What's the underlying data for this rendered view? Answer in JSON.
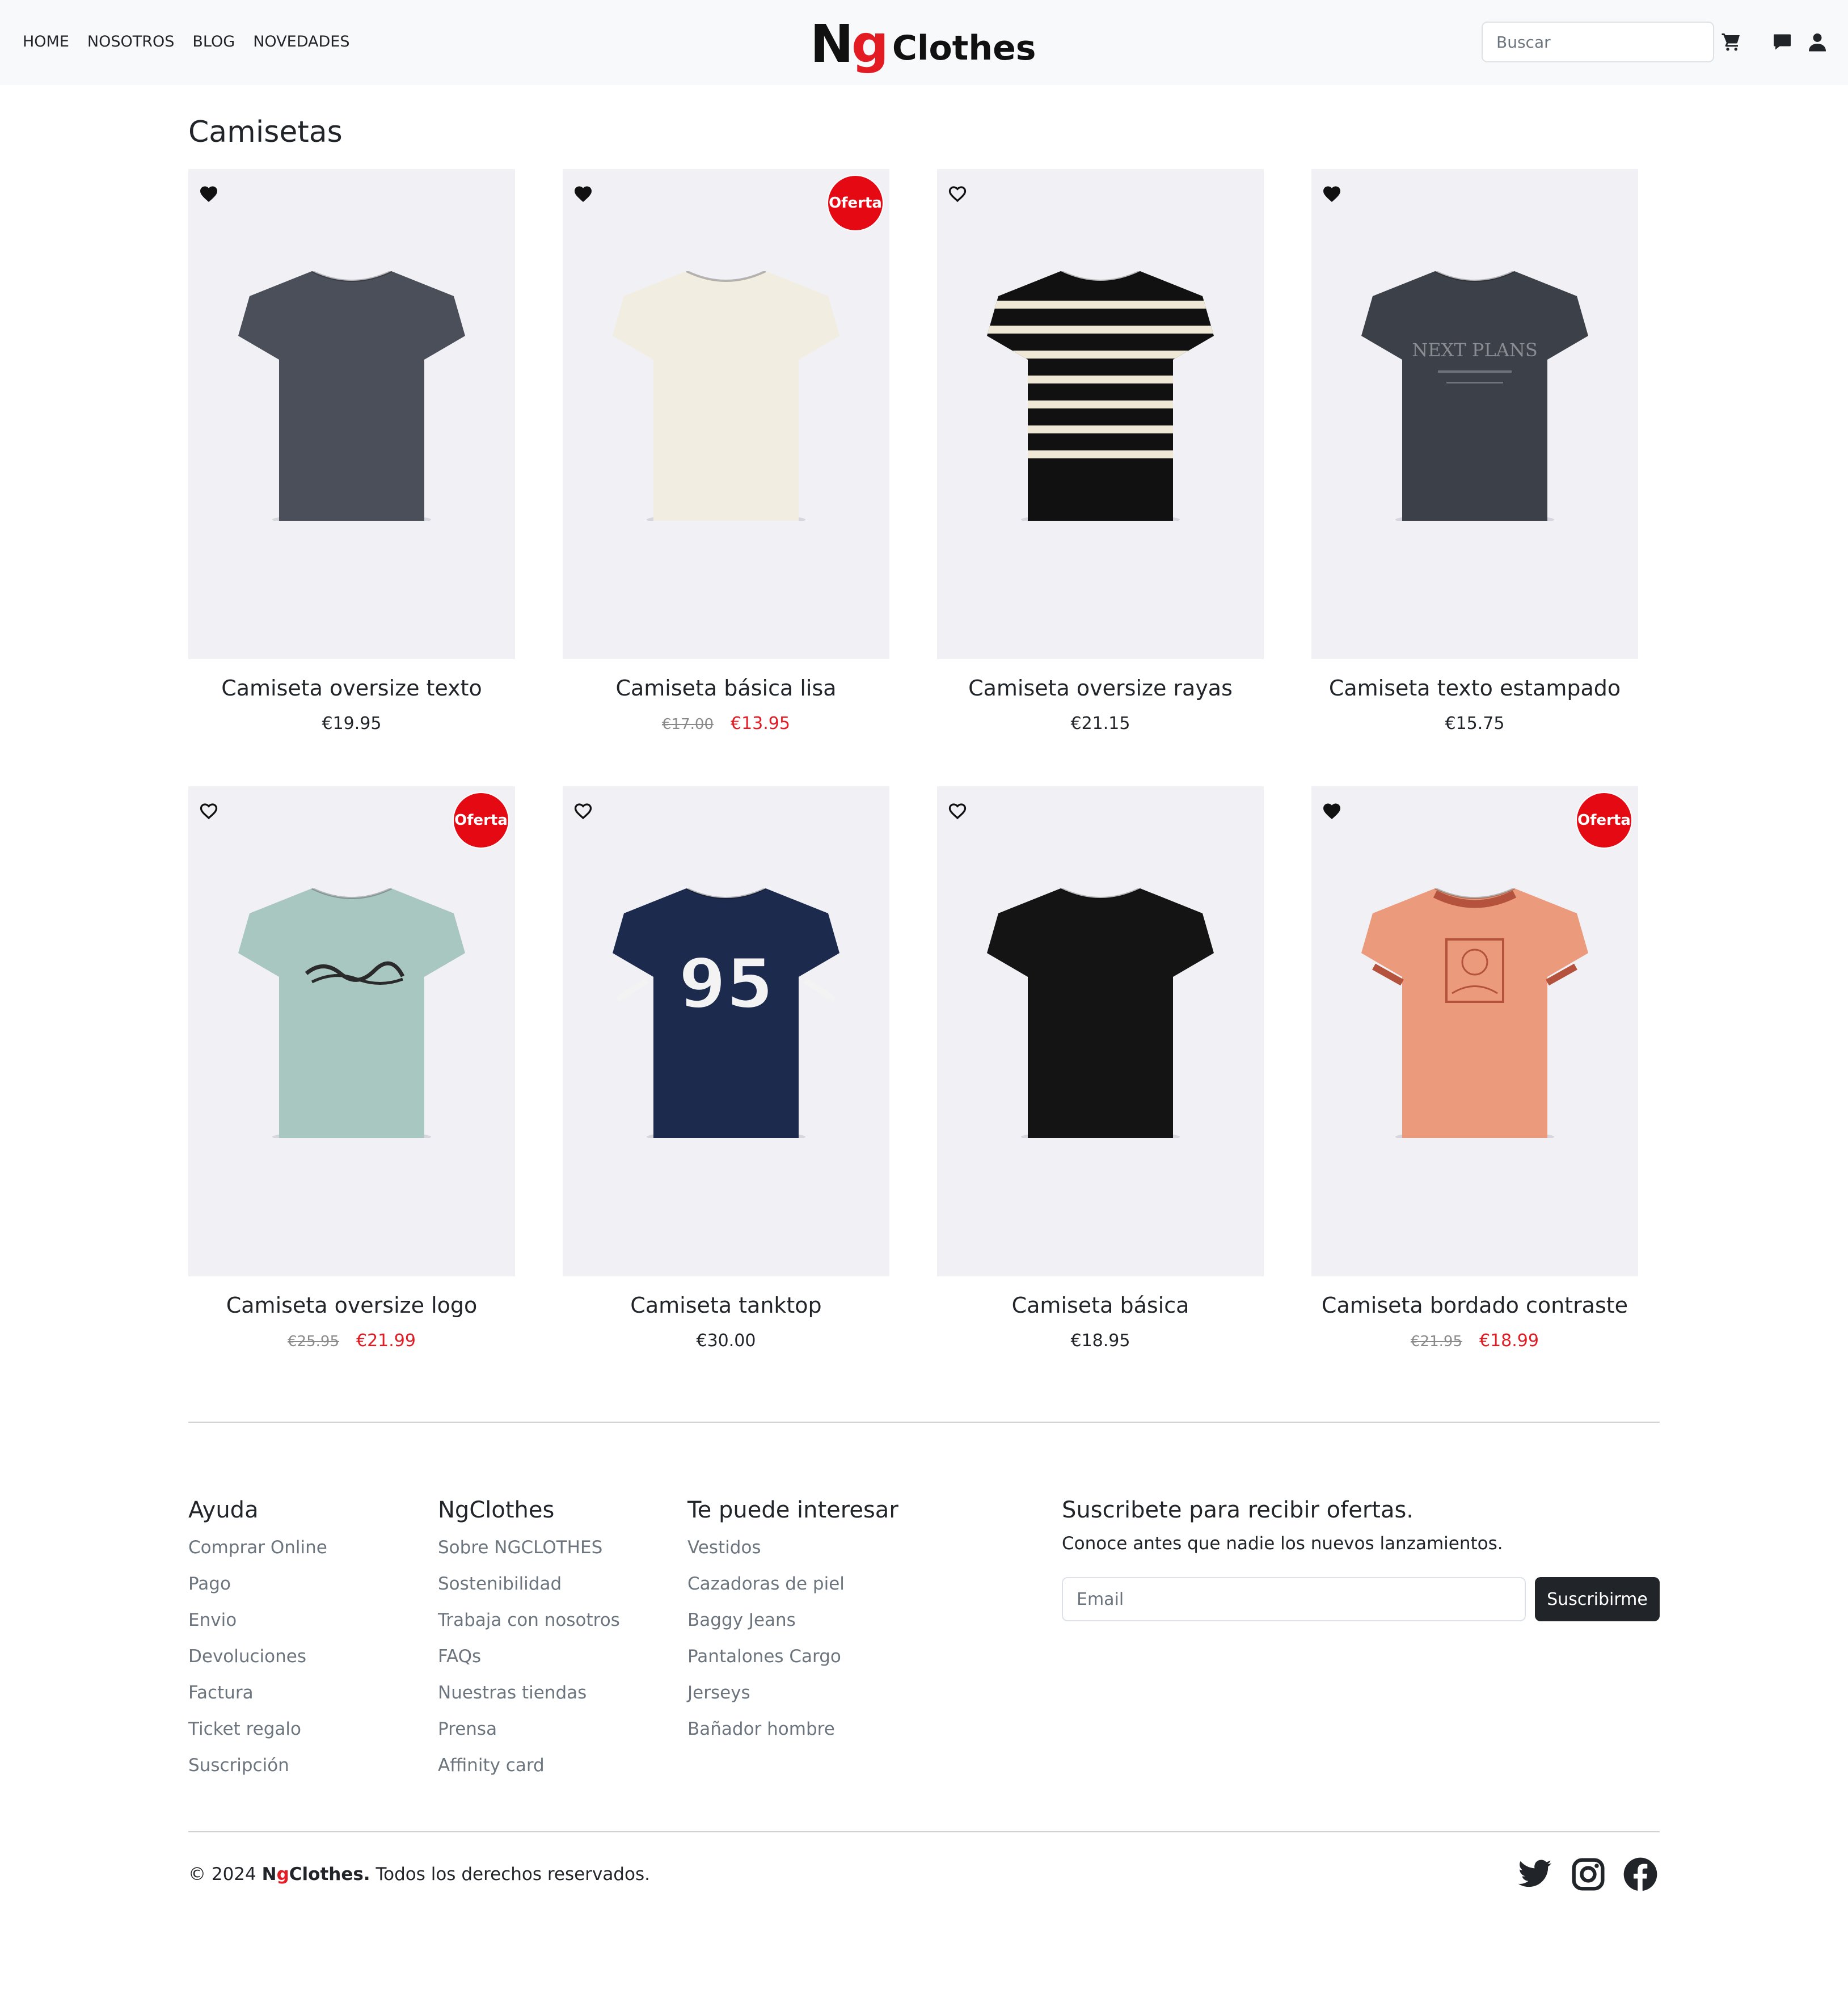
{
  "nav": {
    "items": [
      "HOME",
      "NOSOTROS",
      "BLOG",
      "NOVEDADES"
    ]
  },
  "logo": {
    "n": "N",
    "g": "g",
    "rest": "Clothes"
  },
  "search": {
    "placeholder": "Buscar"
  },
  "header_icons": [
    "cart-icon",
    "chat-icon",
    "user-icon"
  ],
  "page": {
    "title": "Camisetas"
  },
  "colors": {
    "accent": "#e31b23",
    "badge": "#e50914",
    "card_bg": "#f0f0f5",
    "button_dark": "#212529"
  },
  "products": [
    {
      "name": "Camiseta oversize texto",
      "price": "€19.95",
      "old_price": "",
      "sale_price": "",
      "on_sale": false,
      "favorite": true,
      "badge": "",
      "shirt_color": "#4b4f5a",
      "pattern": "none"
    },
    {
      "name": "Camiseta básica lisa",
      "price": "",
      "old_price": "€17.00",
      "sale_price": "€13.95",
      "on_sale": true,
      "favorite": true,
      "badge": "Oferta",
      "shirt_color": "#f2ede1",
      "pattern": "none"
    },
    {
      "name": "Camiseta oversize rayas",
      "price": "€21.15",
      "old_price": "",
      "sale_price": "",
      "on_sale": false,
      "favorite": false,
      "badge": "",
      "shirt_color": "#111111",
      "pattern": "stripes"
    },
    {
      "name": "Camiseta texto estampado",
      "price": "€15.75",
      "old_price": "",
      "sale_price": "",
      "on_sale": false,
      "favorite": true,
      "badge": "",
      "shirt_color": "#3c4048",
      "pattern": "text"
    },
    {
      "name": "Camiseta oversize logo",
      "price": "",
      "old_price": "€25.95",
      "sale_price": "€21.99",
      "on_sale": true,
      "favorite": false,
      "badge": "Oferta",
      "shirt_color": "#a9c7c1",
      "pattern": "logo"
    },
    {
      "name": "Camiseta tanktop",
      "price": "€30.00",
      "old_price": "",
      "sale_price": "",
      "on_sale": false,
      "favorite": false,
      "badge": "",
      "shirt_color": "#1c2a4d",
      "pattern": "number"
    },
    {
      "name": "Camiseta básica",
      "price": "€18.95",
      "old_price": "",
      "sale_price": "",
      "on_sale": false,
      "favorite": false,
      "badge": "",
      "shirt_color": "#141414",
      "pattern": "none"
    },
    {
      "name": "Camiseta bordado contraste",
      "price": "",
      "old_price": "€21.95",
      "sale_price": "€18.99",
      "on_sale": true,
      "favorite": true,
      "badge": "Oferta",
      "shirt_color": "#eb9b7b",
      "pattern": "embroidery"
    }
  ],
  "shirt_prints": {
    "text": "NEXT PLANS",
    "number": "95"
  },
  "footer": {
    "columns": [
      {
        "title": "Ayuda",
        "links": [
          "Comprar Online",
          "Pago",
          "Envio",
          "Devoluciones",
          "Factura",
          "Ticket regalo",
          "Suscripción"
        ]
      },
      {
        "title": "NgClothes",
        "links": [
          "Sobre NGCLOTHES",
          "Sostenibilidad",
          "Trabaja con nosotros",
          "FAQs",
          "Nuestras tiendas",
          "Prensa",
          "Affinity card"
        ]
      },
      {
        "title": "Te puede interesar",
        "links": [
          "Vestidos",
          "Cazadoras de piel",
          "Baggy Jeans",
          "Pantalones Cargo",
          "Jerseys",
          "Bañador hombre"
        ]
      }
    ],
    "subscribe": {
      "title": "Suscribete para recibir ofertas.",
      "text": "Conoce antes que nadie los nuevos lanzamientos.",
      "placeholder": "Email",
      "button": "Suscribirme"
    },
    "copyright": {
      "prefix": "© 2024 ",
      "brand_n": "N",
      "brand_g": "g",
      "brand_rest": "Clothes.",
      "suffix": " Todos los derechos reservados."
    },
    "social": [
      "twitter-icon",
      "instagram-icon",
      "facebook-icon"
    ]
  }
}
